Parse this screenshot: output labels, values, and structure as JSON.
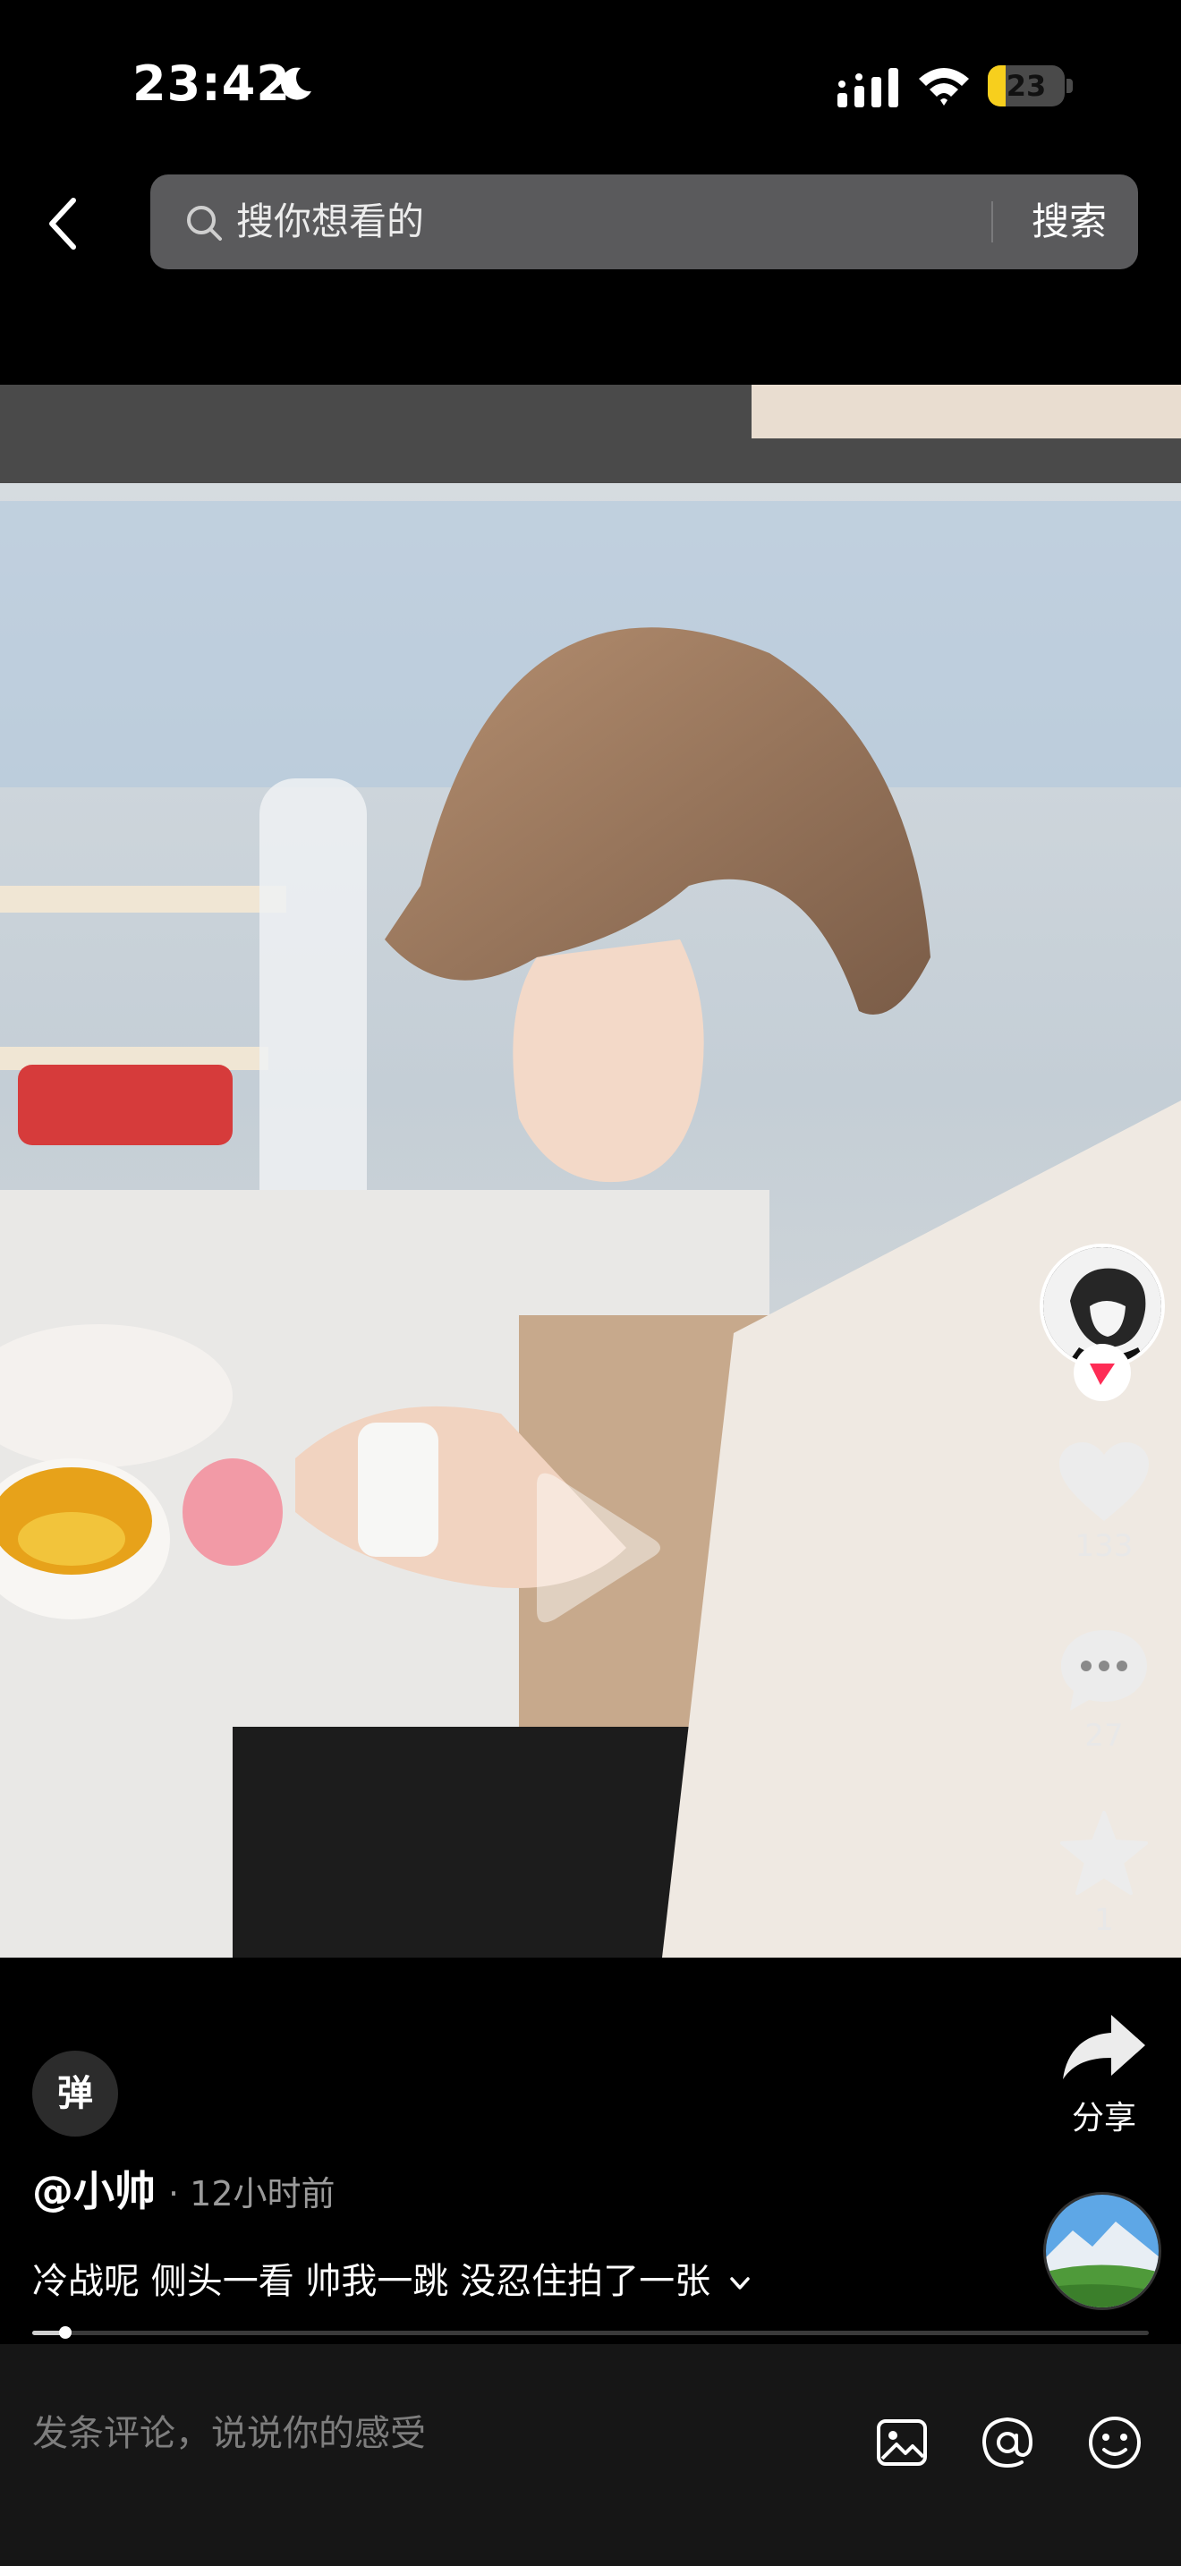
{
  "status_bar": {
    "time": "23:42",
    "battery": "23",
    "battery_level": 0.23
  },
  "search": {
    "placeholder": "搜你想看的",
    "submit_label": "搜索"
  },
  "video": {
    "progress": 0.03
  },
  "actions": {
    "likes": "133",
    "comments": "27",
    "favorites": "1",
    "share_label": "分享"
  },
  "post": {
    "danmu_label": "弹",
    "author": "@小帅",
    "time_ago": "12小时前",
    "caption": "冷战呢 侧头一看 帅我一跳 没忍住拍了一张"
  },
  "comment_bar": {
    "placeholder": "发条评论，说说你的感受"
  },
  "icons": [
    "moon-icon",
    "signal-icon",
    "wifi-icon",
    "battery-icon",
    "back-arrow-icon",
    "search-icon",
    "play-icon",
    "heart-icon",
    "comment-icon",
    "star-icon",
    "share-icon",
    "chevron-down-icon",
    "image-icon",
    "at-icon",
    "emoji-icon"
  ],
  "colors": {
    "battery": "#f7cf1d",
    "follow_badge": "#fe2c55",
    "background": "#000000"
  }
}
